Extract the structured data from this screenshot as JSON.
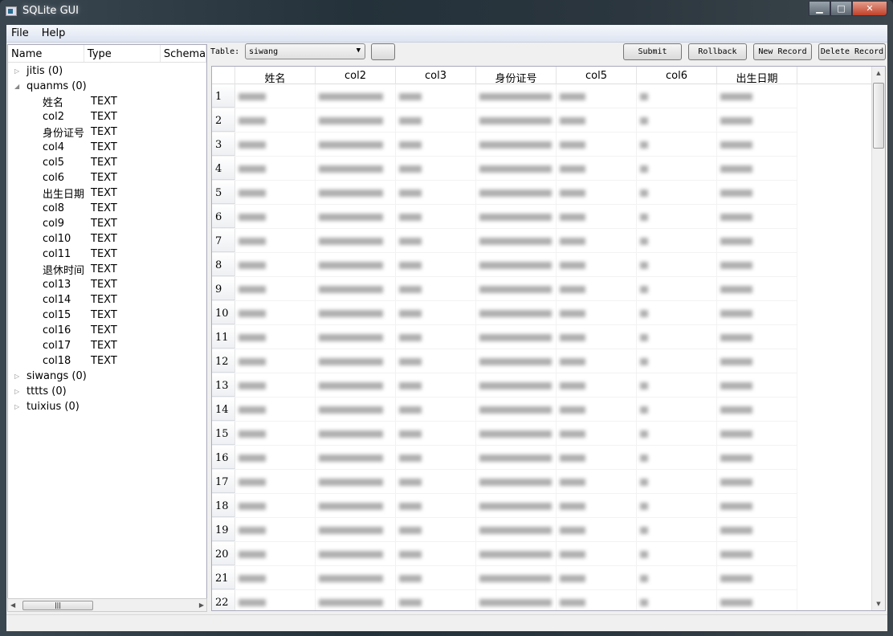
{
  "window": {
    "title": "SQLite GUI"
  },
  "menu": [
    "File",
    "Help"
  ],
  "tree": {
    "headers": [
      "Name",
      "Type",
      "Schema"
    ],
    "items": [
      {
        "name": "jitis (0)",
        "expanded": false
      },
      {
        "name": "quanms (0)",
        "expanded": true,
        "children": [
          [
            "姓名",
            "TEXT"
          ],
          [
            "col2",
            "TEXT"
          ],
          [
            "身份证号",
            "TEXT"
          ],
          [
            "col4",
            "TEXT"
          ],
          [
            "col5",
            "TEXT"
          ],
          [
            "col6",
            "TEXT"
          ],
          [
            "出生日期",
            "TEXT"
          ],
          [
            "col8",
            "TEXT"
          ],
          [
            "col9",
            "TEXT"
          ],
          [
            "col10",
            "TEXT"
          ],
          [
            "col11",
            "TEXT"
          ],
          [
            "退休时间",
            "TEXT"
          ],
          [
            "col13",
            "TEXT"
          ],
          [
            "col14",
            "TEXT"
          ],
          [
            "col15",
            "TEXT"
          ],
          [
            "col16",
            "TEXT"
          ],
          [
            "col17",
            "TEXT"
          ],
          [
            "col18",
            "TEXT"
          ]
        ]
      },
      {
        "name": "siwangs (0)",
        "expanded": false
      },
      {
        "name": "tttts (0)",
        "expanded": false
      },
      {
        "name": "tuixius (0)",
        "expanded": false
      }
    ]
  },
  "toolbar": {
    "table_label": "Table:",
    "table_value": "siwang",
    "submit": "Submit",
    "rollback": "Rollback",
    "new_record": "New Record",
    "delete_record": "Delete Record"
  },
  "grid": {
    "columns": [
      "姓名",
      "col2",
      "col3",
      "身份证号",
      "col5",
      "col6",
      "出生日期"
    ],
    "row_numbers": [
      "1",
      "2",
      "3",
      "4",
      "5",
      "6",
      "7",
      "8",
      "9",
      "10",
      "11",
      "12",
      "13",
      "14",
      "15",
      "16",
      "17",
      "18",
      "19",
      "20",
      "21",
      "22"
    ]
  }
}
